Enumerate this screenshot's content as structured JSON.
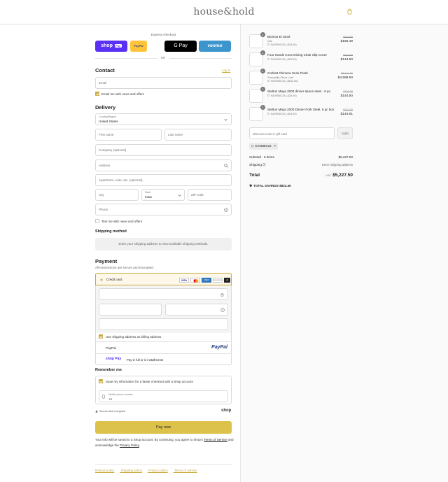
{
  "header": {
    "logo": "house&hold"
  },
  "express": {
    "title": "Express checkout",
    "or": "OR",
    "shop_label": "shop",
    "shop_badge": "Pay",
    "paypal_label": "PayPal",
    "gpay_label": "G Pay",
    "venmo_label": "venmo"
  },
  "contact": {
    "title": "Contact",
    "login": "Log in",
    "email_placeholder": "Email",
    "news_label": "Email me with news and offers"
  },
  "delivery": {
    "title": "Delivery",
    "country_label": "Country/Region",
    "country_value": "United States",
    "first_name": "First name",
    "last_name": "Last name",
    "company": "Company (optional)",
    "address": "Address",
    "apartment": "Apartment, suite, etc. (optional)",
    "city": "City",
    "state_label": "State",
    "state_value": "Iowa",
    "zip": "ZIP code",
    "phone": "Phone",
    "text_label": "Text me with news and offers"
  },
  "shipping": {
    "title": "Shipping method",
    "message": "Enter your shipping address to view available shipping methods."
  },
  "payment": {
    "title": "Payment",
    "subtitle": "All transactions are secure and encrypted.",
    "credit_label": "Credit card",
    "card_logos": [
      "VISA",
      "MC",
      "AMEX",
      "DISCOVER",
      "+5"
    ],
    "billing_label": "Use shipping address as billing address",
    "paypal_label": "PayPal",
    "paypal_logo": "PayPal",
    "shoppay_badge": "shop Pay",
    "shoppay_text": "Pay in full or in installments"
  },
  "remember": {
    "title": "Remember me",
    "save_label": "Save my information for a faster checkout with a Shop account",
    "mobile_label": "Mobile phone number",
    "mobile_value": "+1",
    "secure": "Secure and encrypted",
    "shop_logo": "shop"
  },
  "pay_now": "Pay now",
  "legal": {
    "part1": "Your info will be saved to a Shop account. By continuing, you agree to Shop's ",
    "tos": "Terms of Service",
    "part2": " and acknowledge the ",
    "privacy": "Privacy Policy",
    "end": "."
  },
  "footer": [
    "Refund policy",
    "Shipping policy",
    "Privacy policy",
    "Terms of service"
  ],
  "cart": {
    "items": [
      {
        "qty": "1",
        "name": "Biomus Ei Stool",
        "variant": "Oak",
        "discount": "SAVEBIG15 (-$34.50)",
        "old_price": "$229.99",
        "price": "$195.49"
      },
      {
        "qty": "1",
        "name": "Four Hands Cove Dining Chair Slip Cover",
        "variant": "",
        "discount": "SAVEBIG15 (-$25.50)",
        "old_price": "$170.00",
        "price": "$144.50"
      },
      {
        "qty": "1",
        "name": "Corbett Chimera Semi Flush",
        "variant": "Tranquility Stone Leaf",
        "discount": "SAVEBIG15 (-$811.50)",
        "old_price": "$5,410.00",
        "price": "$4,598.50"
      },
      {
        "qty": "1",
        "name": "Stelton Maya 2000 dinner spoon steel - 6 pc.",
        "variant": "",
        "discount": "SAVEBIG15 (-$25.50)",
        "old_price": "$170.00",
        "price": "$144.50"
      },
      {
        "qty": "1",
        "name": "Stelton Maya 2000 Dinner Fork Steel, 6 pc box",
        "variant": "",
        "discount": "SAVEBIG15 (-$25.49)",
        "old_price": "$170.00",
        "price": "$144.51"
      }
    ],
    "discount_placeholder": "Discount code or gift card",
    "apply": "Apply",
    "applied_code": "SAVEBIG15",
    "subtotal_label": "Subtotal · 5 items",
    "subtotal_value": "$5,227.50",
    "shipping_label": "Shipping",
    "shipping_value": "Enter shipping address",
    "total_label": "Total",
    "currency": "USD",
    "total_value": "$5,227.50",
    "savings_label": "TOTAL SAVINGS",
    "savings_value": "$922.49"
  },
  "colors": {
    "accent": "#c9a938",
    "shop_purple": "#5a31f4",
    "paypal_yellow": "#ffc439",
    "venmo_blue": "#3d95ce"
  }
}
